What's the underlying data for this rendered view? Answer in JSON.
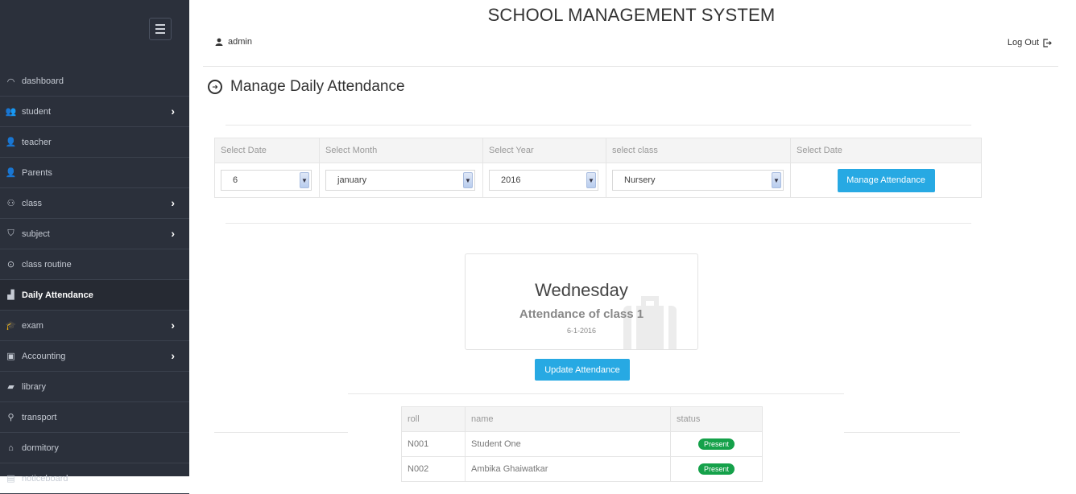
{
  "header": {
    "app_title": "SCHOOL MANAGEMENT SYSTEM",
    "user": "admin",
    "logout": "Log Out"
  },
  "sidebar": {
    "items": [
      {
        "label": "dashboard",
        "icon": "dashboard-icon",
        "glyph": "◠"
      },
      {
        "label": "student",
        "icon": "group-icon",
        "glyph": "👥",
        "submenu": true
      },
      {
        "label": "teacher",
        "icon": "users-icon",
        "glyph": "👤"
      },
      {
        "label": "Parents",
        "icon": "user-icon",
        "glyph": "👤"
      },
      {
        "label": "class",
        "icon": "sitemap-icon",
        "glyph": "⚇",
        "submenu": true
      },
      {
        "label": "subject",
        "icon": "tag-icon",
        "glyph": "⛉",
        "submenu": true
      },
      {
        "label": "class routine",
        "icon": "compass-icon",
        "glyph": "⊙"
      },
      {
        "label": "Daily Attendance",
        "icon": "signal-icon",
        "glyph": "▟",
        "active": true
      },
      {
        "label": "exam",
        "icon": "graduation-cap-icon",
        "glyph": "🎓",
        "submenu": true
      },
      {
        "label": "Accounting",
        "icon": "briefcase-icon",
        "glyph": "▣",
        "submenu": true
      },
      {
        "label": "library",
        "icon": "book-icon",
        "glyph": "▰"
      },
      {
        "label": "transport",
        "icon": "map-marker-icon",
        "glyph": "⚲"
      },
      {
        "label": "dormitory",
        "icon": "home-icon",
        "glyph": "⌂"
      },
      {
        "label": "noticeboard",
        "icon": "calendar-icon",
        "glyph": "▤"
      }
    ]
  },
  "page": {
    "title": "Manage Daily Attendance"
  },
  "filter": {
    "headers": [
      "Select Date",
      "Select Month",
      "Select Year",
      "select class",
      "Select Date"
    ],
    "date_value": "6",
    "month_value": "january",
    "year_value": "2016",
    "class_value": "Nursery",
    "manage_button": "Manage Attendance"
  },
  "card": {
    "day": "Wednesday",
    "subtitle": "Attendance of class 1",
    "date": "6-1-2016"
  },
  "update_button": "Update Attendance",
  "students": {
    "headers": [
      "roll",
      "name",
      "status"
    ],
    "rows": [
      {
        "roll": "N001",
        "name": "Student One",
        "status": "Present"
      },
      {
        "roll": "N002",
        "name": "Ambika Ghaiwatkar",
        "status": "Present"
      }
    ]
  },
  "colors": {
    "sidebar_bg": "#2b303b",
    "accent": "#27a9e3",
    "present": "#15a14a"
  }
}
